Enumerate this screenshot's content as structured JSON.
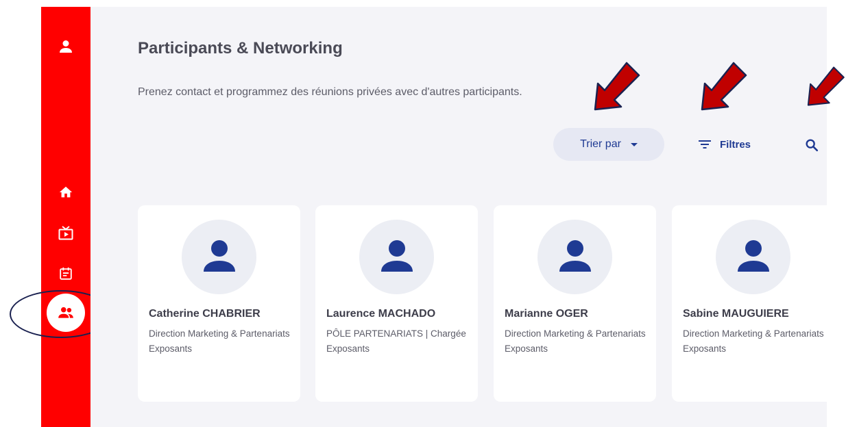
{
  "sidebar": {
    "icons": [
      "user-icon",
      "home-icon",
      "tv-icon",
      "calendar-icon",
      "people-icon"
    ],
    "active": "people",
    "color": "#ff0000"
  },
  "page": {
    "title": "Participants & Networking",
    "subtitle": "Prenez contact et programmez des réunions privées avec d'autres participants."
  },
  "toolbar": {
    "sort_label": "Trier par",
    "filter_label": "Filtres",
    "accent": "#1f3a93"
  },
  "participants": [
    {
      "name": "Catherine CHABRIER",
      "role": "Direction Marketing & Partenariats",
      "group": "Exposants"
    },
    {
      "name": "Laurence MACHADO",
      "role": "PÔLE PARTENARIATS | Chargée",
      "group": "Exposants"
    },
    {
      "name": "Marianne OGER",
      "role": "Direction Marketing & Partenariats",
      "group": "Exposants"
    },
    {
      "name": "Sabine MAUGUIERE",
      "role": "Direction Marketing & Partenariats",
      "group": "Exposants"
    }
  ],
  "annotations": {
    "arrow_color": "#c00000",
    "circle_color": "#1a2150"
  }
}
